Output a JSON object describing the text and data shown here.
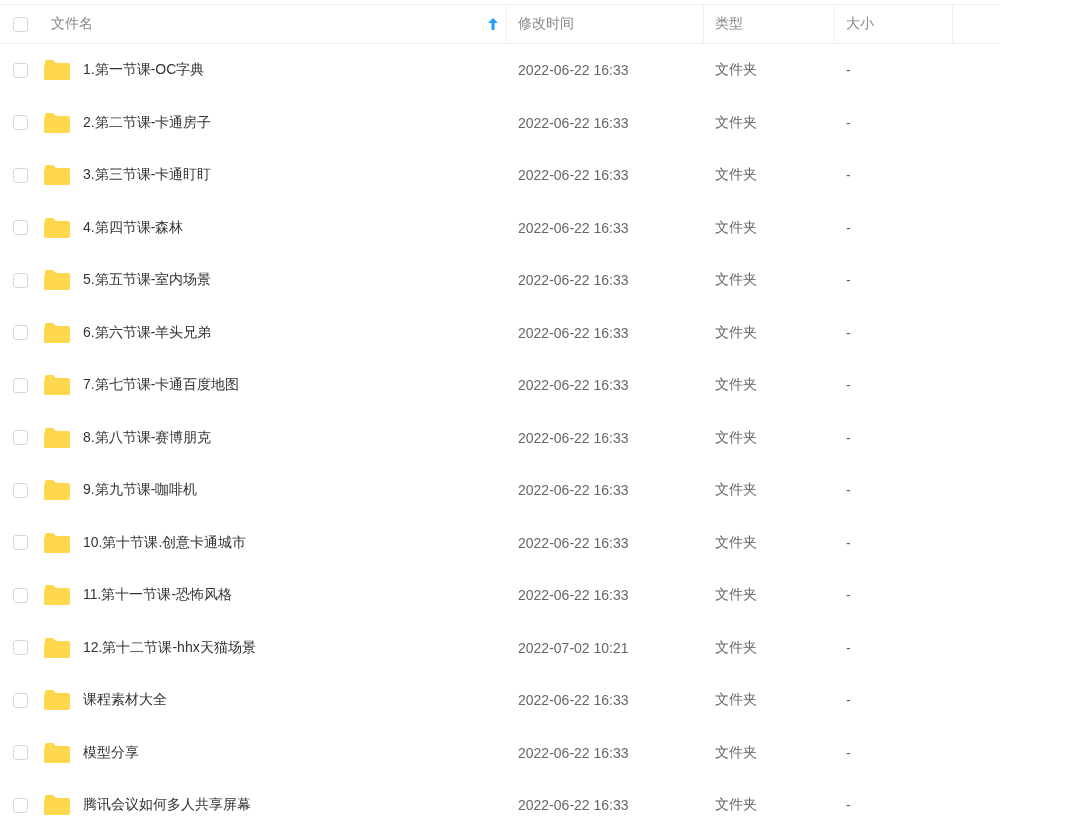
{
  "table": {
    "header_checked": false,
    "columns": [
      {
        "label": "文件名",
        "sorted": true
      },
      {
        "label": "修改时间",
        "sorted": false
      },
      {
        "label": "类型",
        "sorted": false
      },
      {
        "label": "大小",
        "sorted": false
      }
    ],
    "rows": [
      {
        "name": "1.第一节课-OC字典",
        "modified": "2022-06-22 16:33",
        "type": "文件夹",
        "size": "-",
        "checked": false
      },
      {
        "name": "2.第二节课-卡通房子",
        "modified": "2022-06-22 16:33",
        "type": "文件夹",
        "size": "-",
        "checked": false
      },
      {
        "name": "3.第三节课-卡通盯盯",
        "modified": "2022-06-22 16:33",
        "type": "文件夹",
        "size": "-",
        "checked": false
      },
      {
        "name": "4.第四节课-森林",
        "modified": "2022-06-22 16:33",
        "type": "文件夹",
        "size": "-",
        "checked": false
      },
      {
        "name": "5.第五节课-室内场景",
        "modified": "2022-06-22 16:33",
        "type": "文件夹",
        "size": "-",
        "checked": false
      },
      {
        "name": "6.第六节课-羊头兄弟",
        "modified": "2022-06-22 16:33",
        "type": "文件夹",
        "size": "-",
        "checked": false
      },
      {
        "name": "7.第七节课-卡通百度地图",
        "modified": "2022-06-22 16:33",
        "type": "文件夹",
        "size": "-",
        "checked": false
      },
      {
        "name": "8.第八节课-赛博朋克",
        "modified": "2022-06-22 16:33",
        "type": "文件夹",
        "size": "-",
        "checked": false
      },
      {
        "name": "9.第九节课-咖啡机",
        "modified": "2022-06-22 16:33",
        "type": "文件夹",
        "size": "-",
        "checked": false
      },
      {
        "name": "10.第十节课.创意卡通城市",
        "modified": "2022-06-22 16:33",
        "type": "文件夹",
        "size": "-",
        "checked": false
      },
      {
        "name": "11.第十一节课-恐怖风格",
        "modified": "2022-06-22 16:33",
        "type": "文件夹",
        "size": "-",
        "checked": false
      },
      {
        "name": "12.第十二节课-hhx天猫场景",
        "modified": "2022-07-02 10:21",
        "type": "文件夹",
        "size": "-",
        "checked": false
      },
      {
        "name": "课程素材大全",
        "modified": "2022-06-22 16:33",
        "type": "文件夹",
        "size": "-",
        "checked": false
      },
      {
        "name": "模型分享",
        "modified": "2022-06-22 16:33",
        "type": "文件夹",
        "size": "-",
        "checked": false
      },
      {
        "name": "腾讯会议如何多人共享屏幕",
        "modified": "2022-06-22 16:33",
        "type": "文件夹",
        "size": "-",
        "checked": false
      }
    ]
  }
}
